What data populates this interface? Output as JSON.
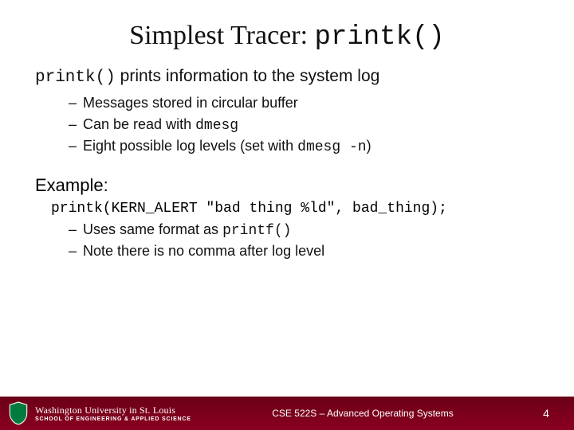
{
  "title_prefix": "Simplest Tracer: ",
  "title_code": "printk()",
  "lead_code": "printk()",
  "lead_text": " prints information to the system log",
  "bullets1": [
    {
      "t1": "Messages stored in circular buffer",
      "c1": "",
      "t2": "",
      "c2": "",
      "t3": ""
    },
    {
      "t1": "Can be read with ",
      "c1": "dmesg",
      "t2": "",
      "c2": "",
      "t3": ""
    },
    {
      "t1": "Eight possible log levels (set with ",
      "c1": "dmesg -n",
      "t2": ")",
      "c2": "",
      "t3": ""
    }
  ],
  "example_label": "Example:",
  "example_code": "printk(KERN_ALERT \"bad thing %ld\", bad_thing);",
  "bullets2": [
    {
      "t1": "Uses same format as ",
      "c1": "printf()",
      "t2": ""
    },
    {
      "t1": "Note there is no comma after log level",
      "c1": "",
      "t2": ""
    }
  ],
  "footer": {
    "uni_top": "Washington University in St. Louis",
    "uni_bot": "SCHOOL OF ENGINEERING & APPLIED SCIENCE",
    "course": "CSE 522S – Advanced Operating Systems",
    "page": "4"
  }
}
